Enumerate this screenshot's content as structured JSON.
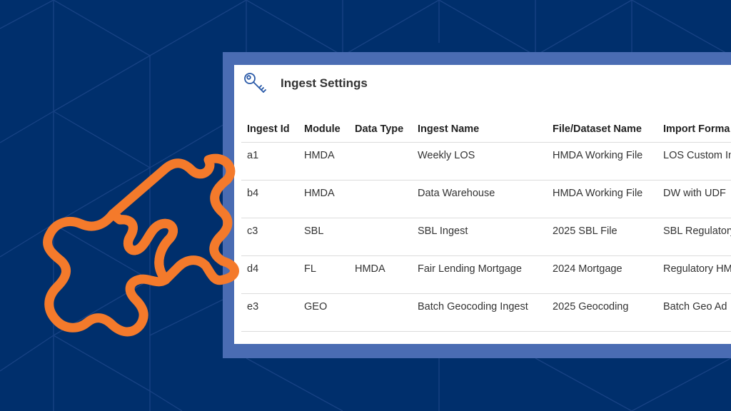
{
  "panel": {
    "title": "Ingest Settings",
    "icon": "key-icon"
  },
  "table": {
    "columns": [
      "Ingest Id",
      "Module",
      "Data Type",
      "Ingest Name",
      "File/Dataset Name",
      "Import Forma"
    ],
    "rows": [
      [
        "a1",
        "HMDA",
        "",
        "Weekly LOS",
        "HMDA Working File",
        "LOS Custom In"
      ],
      [
        "b4",
        "HMDA",
        "",
        "Data Warehouse",
        "HMDA Working File",
        "DW with UDF"
      ],
      [
        "c3",
        "SBL",
        "",
        "SBL Ingest",
        "2025 SBL File",
        "SBL Regulatory"
      ],
      [
        "d4",
        "FL",
        "HMDA",
        "Fair Lending Mortgage",
        "2024 Mortgage",
        "Regulatory HM"
      ],
      [
        "e3",
        "GEO",
        "",
        "Batch Geocoding Ingest",
        "2025 Geocoding",
        "Batch Geo Ad"
      ]
    ]
  },
  "colors": {
    "background": "#002f6c",
    "panel_frame": "#4a6cb3",
    "puzzle": "#f47a2b",
    "key_icon": "#2a5aa8"
  },
  "decor": {
    "puzzle_icon": "puzzle-pieces-icon"
  }
}
